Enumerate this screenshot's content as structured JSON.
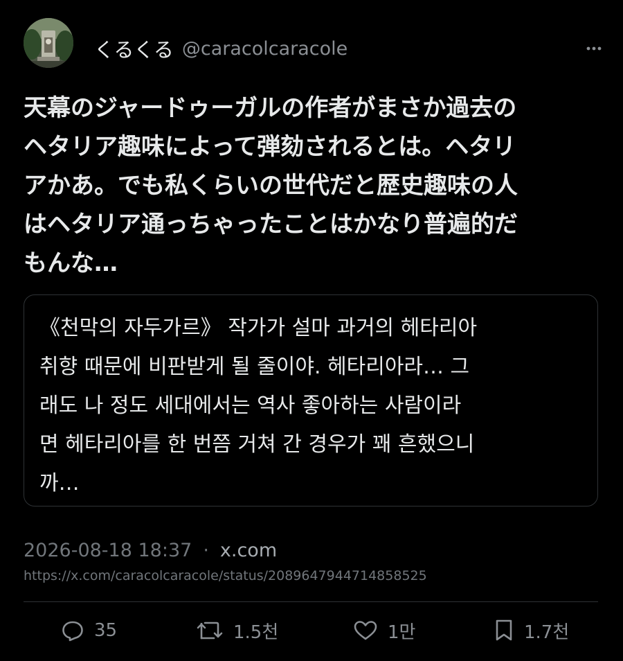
{
  "user": {
    "display_name": "くるくる",
    "handle": "@caracolcaracole"
  },
  "tweet": {
    "text": "天幕のジャードゥーガルの作者がまさか過去の\nヘタリア趣味によって弾劾されるとは。ヘタリ\nアかあ。でも私くらいの世代だと歴史趣味の人\nはヘタリア通っちゃったことはかなり普遍的だ\nもんな…",
    "translation": "《천막의 자두가르》 작가가 설마 과거의 헤타리아\n취향 때문에 비판받게 될 줄이야. 헤타리아라… 그\n래도 나 정도 세대에서는 역사 좋아하는 사람이라\n면 헤타리아를 한 번쯤 거쳐 간 경우가 꽤 흔했으니\n까…",
    "timestamp": "2026-08-18 18:37",
    "separator": "·",
    "source_domain": "x.com",
    "url": "https://x.com/caracolcaracole/status/2089647944714858525"
  },
  "actions": {
    "replies": "35",
    "retweets": "1.5천",
    "likes": "1만",
    "bookmarks": "1.7천"
  },
  "icons": {
    "more": "more-horizontal-icon",
    "reply": "reply-icon",
    "retweet": "retweet-icon",
    "like": "heart-icon",
    "bookmark": "bookmark-icon"
  },
  "colors": {
    "background": "#000000",
    "text": "#e7e9ea",
    "muted": "#71767b",
    "border": "#2f3336"
  }
}
